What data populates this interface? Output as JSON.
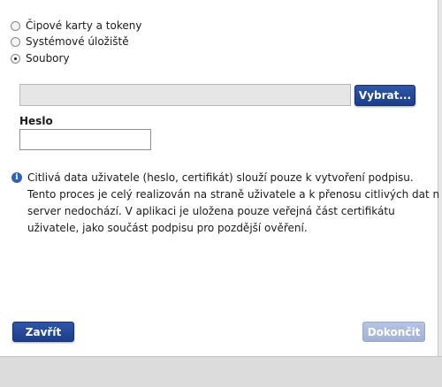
{
  "store_options": [
    {
      "label": "Čipové karty a tokeny",
      "selected": false
    },
    {
      "label": "Systémové úložiště",
      "selected": false
    },
    {
      "label": "Soubory",
      "selected": true
    }
  ],
  "file": {
    "path_value": "",
    "browse_label": "Vybrat..."
  },
  "password": {
    "label": "Heslo",
    "value": ""
  },
  "info": {
    "lines": [
      "Citlivá data uživatele (heslo, certifikát) slouží pouze k vytvoření podpisu.",
      "Tento proces je celý realizován na straně uživatele a k přenosu citlivých dat na",
      "server nedochází. V aplikaci je uložena pouze veřejná část certifikátu",
      "uživatele, jako součást podpisu pro pozdější ověření."
    ]
  },
  "footer": {
    "close_label": "Zavřít",
    "finish_label": "Dokončit",
    "finish_enabled": false
  },
  "colors": {
    "button_primary": "#1c3e8c",
    "button_disabled": "#a2b2d6",
    "info_icon": "#2f63b8"
  },
  "icons": {
    "info": "info-icon"
  }
}
